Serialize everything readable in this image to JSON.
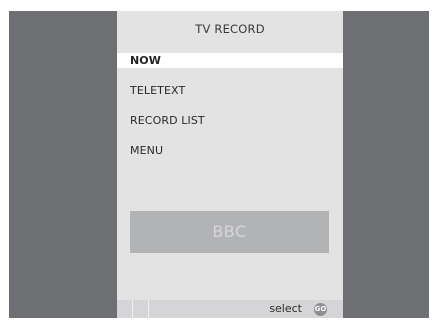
{
  "menu_title": "TV  RECORD",
  "menu": {
    "items": [
      {
        "label": "NOW",
        "selected": true
      },
      {
        "label": "TELETEXT",
        "selected": false
      },
      {
        "label": "RECORD  LIST",
        "selected": false
      },
      {
        "label": "MENU",
        "selected": false
      }
    ]
  },
  "channel": {
    "name": "BBC"
  },
  "footer": {
    "hint_label": "select",
    "go_icon_label": "GO",
    "go_icon": "go-button-icon"
  },
  "colors": {
    "frame_background": "#6e6f72",
    "panel_background": "#e3e3e4",
    "selected_item_background": "#ffffff",
    "channel_box_background": "#b2b3b5",
    "footer_background": "#d5d5d7"
  }
}
